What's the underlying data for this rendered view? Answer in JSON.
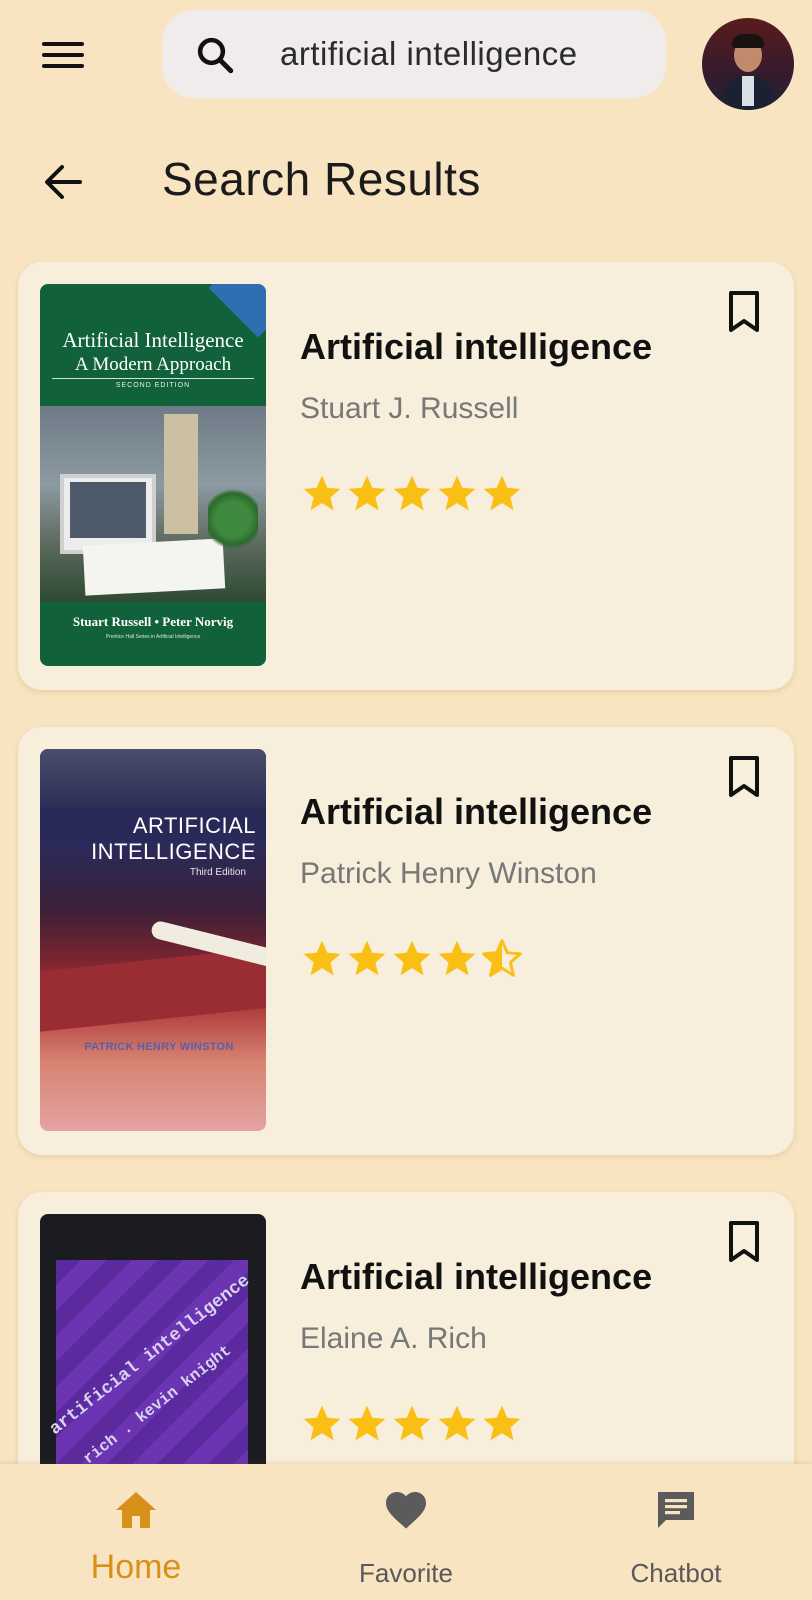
{
  "search": {
    "query": "artificial intelligence"
  },
  "header": {
    "title": "Search Results"
  },
  "results": [
    {
      "title": "Artificial intelligence",
      "author": "Stuart J. Russell",
      "rating": 5,
      "cover": {
        "line1": "Artificial Intelligence",
        "line2": "A Modern Approach",
        "edition": "SECOND EDITION",
        "authors": "Stuart Russell • Peter Norvig",
        "series": "Prentice Hall Series in Artificial Intelligence"
      }
    },
    {
      "title": "Artificial intelligence",
      "author": "Patrick Henry Winston",
      "rating": 4.5,
      "cover": {
        "line1": "ARTIFICIAL",
        "line2": "INTELLIGENCE",
        "edition": "Third Edition",
        "authors": "PATRICK HENRY WINSTON"
      }
    },
    {
      "title": "Artificial intelligence",
      "author": "Elaine A. Rich",
      "rating": 5,
      "cover": {
        "line1": "artificial intelligence",
        "line2": "rich . kevin knight"
      }
    }
  ],
  "nav": {
    "home_label": "Home",
    "favorite_label": "Favorite",
    "chatbot_label": "Chatbot"
  },
  "colors": {
    "background": "#f9e4c1",
    "card": "#f7efdb",
    "accent": "#d89118",
    "star": "#f9bf15",
    "muted_text": "#777777"
  },
  "icons": [
    "menu-icon",
    "search-icon",
    "back-arrow-icon",
    "bookmark-icon",
    "star-icon",
    "star-half-icon",
    "home-icon",
    "heart-icon",
    "chat-icon"
  ]
}
